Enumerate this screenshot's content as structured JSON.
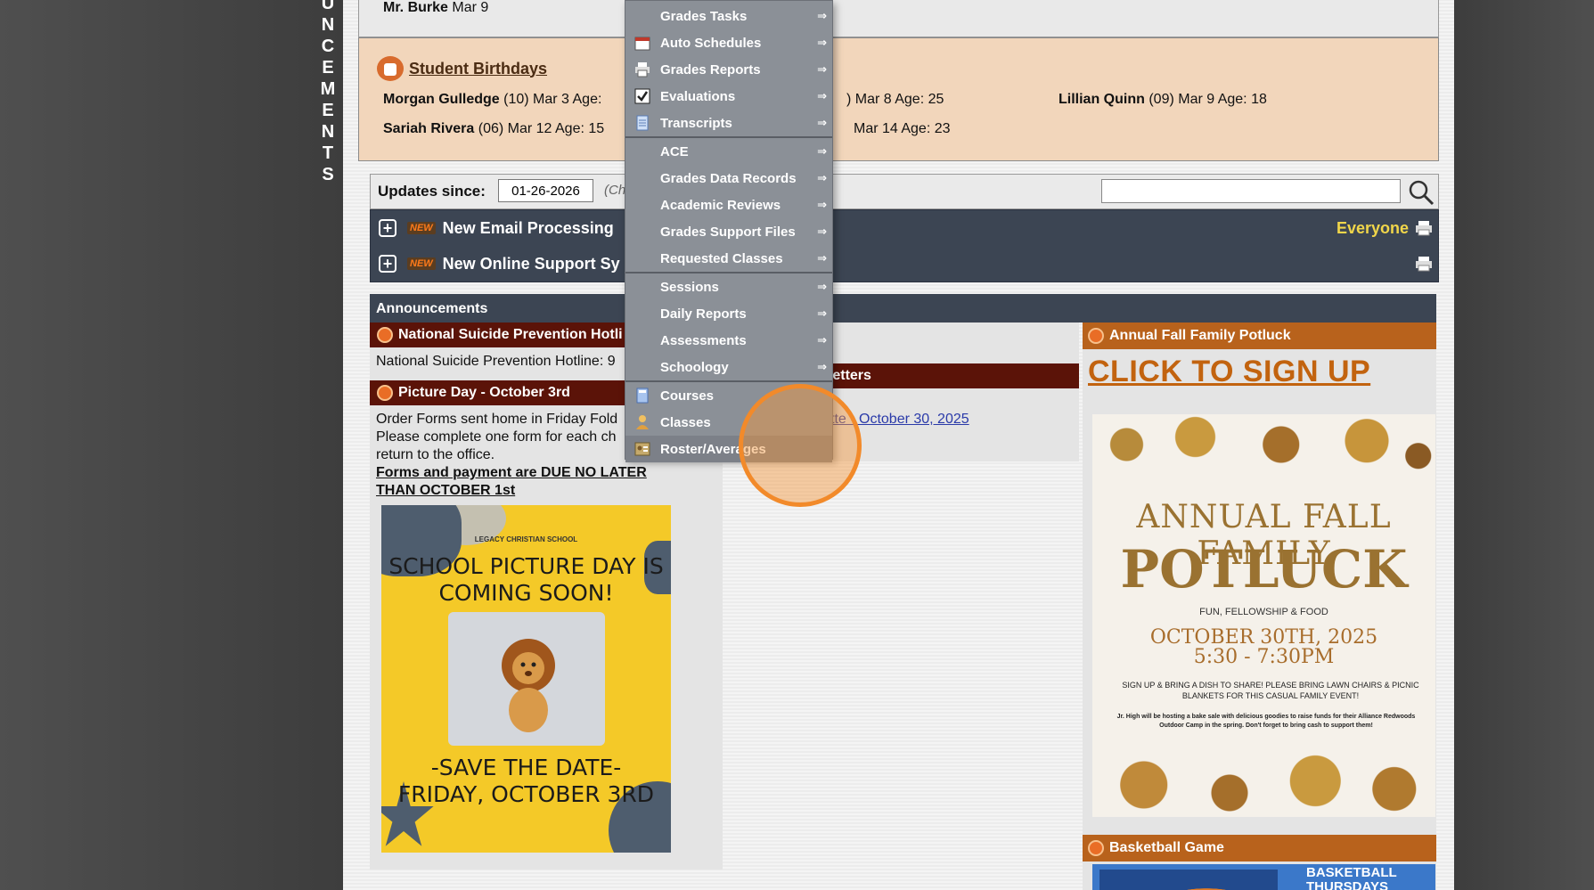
{
  "vertical_word_letters": [
    "U",
    "N",
    "C",
    "E",
    "M",
    "E",
    "N",
    "T",
    "S"
  ],
  "top_strip": {
    "name": "Mr. Burke",
    "date": "Mar 9"
  },
  "birthdays": {
    "title": "Student Birthdays",
    "entries": [
      {
        "name": "Morgan Gulledge",
        "grade": "(10)",
        "info": "Mar 3 Age:"
      },
      {
        "name": "",
        "grade": "",
        "info": ") Mar 8 Age: 25"
      },
      {
        "name": "Lillian Quinn",
        "grade": "(09)",
        "info": "Mar 9 Age: 18"
      },
      {
        "name": "Sariah Rivera",
        "grade": "(06)",
        "info": "Mar 12 Age: 15"
      },
      {
        "name": "",
        "grade": "",
        "info": "Mar 14 Age: 23"
      }
    ]
  },
  "updates": {
    "label": "Updates since:",
    "date": "01-26-2026",
    "hint": "(Ch"
  },
  "news": [
    {
      "badge": "NEW",
      "title": "New Email Processing",
      "audience": "Everyone"
    },
    {
      "badge": "NEW",
      "title": "New Online Support Sy",
      "audience": ""
    }
  ],
  "announcements": {
    "header": "Announcements",
    "left": {
      "item1_title": "National Suicide Prevention Hotli",
      "item1_text": "National Suicide Prevention Hotline: 9",
      "item2_title": "Picture Day - October 3rd",
      "item2_text1": "Order Forms sent home in Friday Fold",
      "item2_text2": "Please complete one form for each ch",
      "item2_text3": "return to the office.",
      "item2_bold1": "Forms and payment are DUE NO LATER",
      "item2_bold2": "THAN OCTOBER 1st",
      "poster": {
        "school": "LEGACY CHRISTIAN SCHOOL",
        "headline1": "SCHOOL PICTURE DAY IS",
        "headline2": "COMING SOON!",
        "save1": "-SAVE THE DATE-",
        "save2": "FRIDAY, OCTOBER 3RD"
      }
    },
    "middle": {
      "head": "sletters",
      "link": "tte - October 30, 2025"
    },
    "right": {
      "potluck_title": "Annual Fall Family Potluck",
      "signup": "CLICK TO SIGN UP",
      "poster": {
        "line1": "ANNUAL FALL FAMILY",
        "line2": "POTLUCK",
        "sub": "FUN, FELLOWSHIP & FOOD",
        "date1": "OCTOBER 30TH, 2025",
        "date2": "5:30 - 7:30PM",
        "small": "SIGN UP & BRING A DISH TO SHARE! PLEASE BRING LAWN CHAIRS & PICNIC BLANKETS FOR THIS CASUAL FAMILY EVENT!",
        "tiny": "Jr. High will be hosting a bake sale with delicious goodies to raise funds for their Alliance Redwoods Outdoor Camp in the spring. Don't forget to bring cash to support them!"
      },
      "basketball_title": "Basketball Game",
      "basketball_text1": "BASKETBALL",
      "basketball_text2": "THURSDAYS"
    }
  },
  "dropdown": {
    "items": [
      {
        "label": "Grades Tasks",
        "arrow": "⇒",
        "icon": "none"
      },
      {
        "label": "Auto Schedules",
        "arrow": "⇒",
        "icon": "calendar-icon"
      },
      {
        "label": "Grades Reports",
        "arrow": "⇒",
        "icon": "printer-icon"
      },
      {
        "label": "Evaluations",
        "arrow": "⇒",
        "icon": "checkbox-icon"
      },
      {
        "label": "Transcripts",
        "arrow": "⇒",
        "icon": "document-icon"
      },
      {
        "label": "ACE",
        "arrow": "⇒",
        "icon": "none"
      },
      {
        "label": "Grades Data Records",
        "arrow": "⇒",
        "icon": "none"
      },
      {
        "label": "Academic Reviews",
        "arrow": "⇒",
        "icon": "none"
      },
      {
        "label": "Grades Support Files",
        "arrow": "⇒",
        "icon": "none"
      },
      {
        "label": "Requested Classes",
        "arrow": "⇒",
        "icon": "none"
      },
      {
        "label": "Sessions",
        "arrow": "⇒",
        "icon": "none"
      },
      {
        "label": "Daily Reports",
        "arrow": "⇒",
        "icon": "none"
      },
      {
        "label": "Assessments",
        "arrow": "⇒",
        "icon": "none"
      },
      {
        "label": "Schoology",
        "arrow": "⇒",
        "icon": "none"
      },
      {
        "label": "Courses",
        "arrow": "",
        "icon": "book-icon"
      },
      {
        "label": "Classes",
        "arrow": "",
        "icon": "person-icon"
      },
      {
        "label": "Roster/Averages",
        "arrow": "",
        "icon": "roster-icon"
      }
    ]
  },
  "colors": {
    "dropdown_bg": "#8b9097",
    "nav_dark": "#3c4553",
    "announce_red": "#5b1308",
    "announce_orange": "#b8621c",
    "link_orange": "#c2630f",
    "highlight_yellow": "#f1d64a"
  }
}
